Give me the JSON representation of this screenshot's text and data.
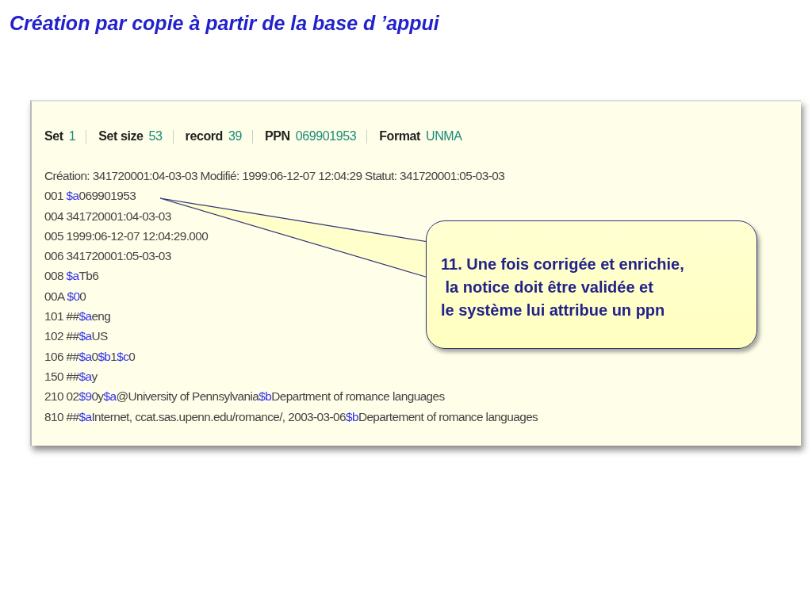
{
  "slide_title": "Création par copie à partir de la base d ’appui",
  "header": [
    {
      "label": "Set",
      "value": "1"
    },
    {
      "label": "Set size",
      "value": "53"
    },
    {
      "label": "record",
      "value": "39"
    },
    {
      "label": "PPN",
      "value": "069901953"
    },
    {
      "label": "Format",
      "value": "UNMA"
    }
  ],
  "record_lines": [
    [
      {
        "kind": "text",
        "text": "Création: 341720001:04-03-03 Modifié: 1999:06-12-07 12:04:29 Statut: 341720001:05-03-03"
      }
    ],
    [
      {
        "kind": "text",
        "text": "001 "
      },
      {
        "kind": "code",
        "text": "$a"
      },
      {
        "kind": "text",
        "text": "069901953"
      }
    ],
    [
      {
        "kind": "text",
        "text": "004 341720001:04-03-03"
      }
    ],
    [
      {
        "kind": "text",
        "text": "005 1999:06-12-07 12:04:29.000"
      }
    ],
    [
      {
        "kind": "text",
        "text": "006 341720001:05-03-03"
      }
    ],
    [
      {
        "kind": "text",
        "text": "008 "
      },
      {
        "kind": "code",
        "text": "$a"
      },
      {
        "kind": "text",
        "text": "Tb6"
      }
    ],
    [
      {
        "kind": "text",
        "text": "00A "
      },
      {
        "kind": "code",
        "text": "$0"
      },
      {
        "kind": "text",
        "text": "0"
      }
    ],
    [
      {
        "kind": "text",
        "text": "101 ##"
      },
      {
        "kind": "code",
        "text": "$a"
      },
      {
        "kind": "text",
        "text": "eng"
      }
    ],
    [
      {
        "kind": "text",
        "text": "102 ##"
      },
      {
        "kind": "code",
        "text": "$a"
      },
      {
        "kind": "text",
        "text": "US"
      }
    ],
    [
      {
        "kind": "text",
        "text": "106 ##"
      },
      {
        "kind": "code",
        "text": "$a"
      },
      {
        "kind": "text",
        "text": "0"
      },
      {
        "kind": "code",
        "text": "$b"
      },
      {
        "kind": "text",
        "text": "1"
      },
      {
        "kind": "code",
        "text": "$c"
      },
      {
        "kind": "text",
        "text": "0"
      }
    ],
    [
      {
        "kind": "text",
        "text": "150 ##"
      },
      {
        "kind": "code",
        "text": "$a"
      },
      {
        "kind": "text",
        "text": "y"
      }
    ],
    [
      {
        "kind": "text",
        "text": "210 02"
      },
      {
        "kind": "code",
        "text": "$9"
      },
      {
        "kind": "text",
        "text": "0y"
      },
      {
        "kind": "code",
        "text": "$a"
      },
      {
        "kind": "text",
        "text": "@University of Pennsylvania"
      },
      {
        "kind": "code",
        "text": "$b"
      },
      {
        "kind": "text",
        "text": "Department of romance languages"
      }
    ],
    [
      {
        "kind": "text",
        "text": "810 ##"
      },
      {
        "kind": "code",
        "text": "$a"
      },
      {
        "kind": "text",
        "text": "Internet, ccat.sas.upenn.edu/romance/, 2003-03-06"
      },
      {
        "kind": "code",
        "text": "$b"
      },
      {
        "kind": "text",
        "text": "Departement of romance languages"
      }
    ]
  ],
  "callout": {
    "lines": [
      "11. Une fois corrigée et enrichie,",
      " la notice doit être validée et",
      "le système lui attribue un ppn"
    ]
  }
}
